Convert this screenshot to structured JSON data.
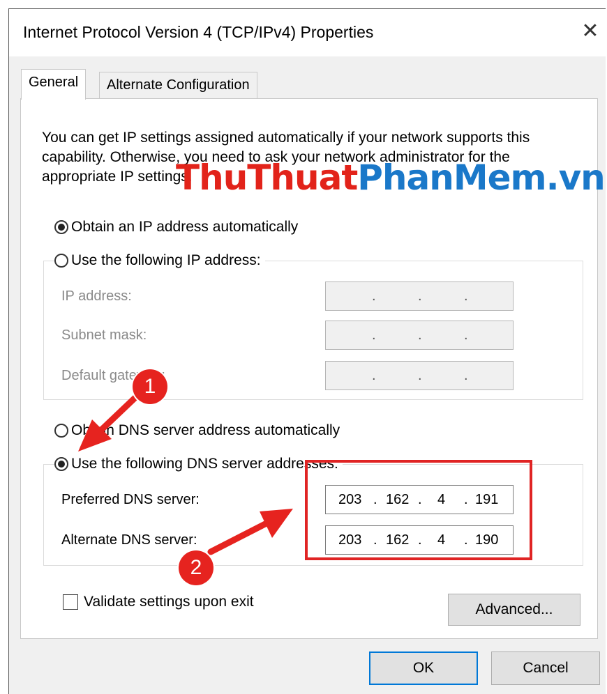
{
  "window": {
    "title": "Internet Protocol Version 4 (TCP/IPv4) Properties",
    "close_glyph": "✕"
  },
  "tabs": [
    {
      "label": "General",
      "selected": true
    },
    {
      "label": "Alternate Configuration",
      "selected": false
    }
  ],
  "general": {
    "description": "You can get IP settings assigned automatically if your network supports this capability. Otherwise, you need to ask your network administrator for the appropriate IP settings.",
    "ip_mode": {
      "auto_label": "Obtain an IP address automatically",
      "manual_label": "Use the following IP address:",
      "selected": "auto"
    },
    "ip_fields": [
      {
        "label": "IP address:",
        "value": ". . ."
      },
      {
        "label": "Subnet mask:",
        "value": ". . ."
      },
      {
        "label": "Default gateway:",
        "value": ". . ."
      }
    ],
    "dns_mode": {
      "auto_label": "Obtain DNS server address automatically",
      "manual_label": "Use the following DNS server addresses:",
      "selected": "manual"
    },
    "dns_fields": [
      {
        "label": "Preferred DNS server:",
        "octets": [
          "203",
          "162",
          "4",
          "191"
        ]
      },
      {
        "label": "Alternate DNS server:",
        "octets": [
          "203",
          "162",
          "4",
          "190"
        ]
      }
    ],
    "validate_label": "Validate settings upon exit",
    "validate_checked": false,
    "advanced_label": "Advanced..."
  },
  "buttons": {
    "ok": "OK",
    "cancel": "Cancel"
  },
  "watermark": {
    "part1": "ThuThuat",
    "part2": "PhanMem.vn"
  },
  "annotations": {
    "badge1": "1",
    "badge2": "2",
    "color": "#e6231f"
  }
}
